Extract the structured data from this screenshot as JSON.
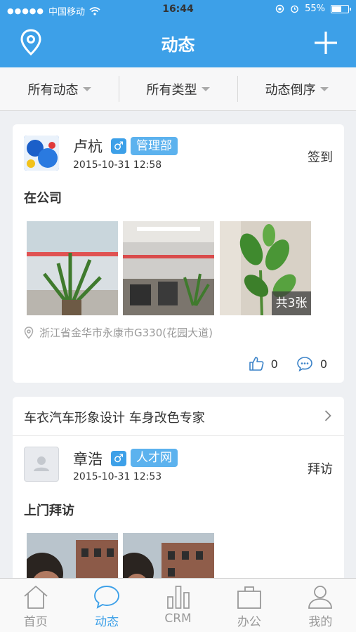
{
  "status_bar": {
    "carrier": "中国移动",
    "time": "16:44",
    "battery": "55%"
  },
  "header": {
    "title": "动态"
  },
  "filters": [
    {
      "label": "所有动态"
    },
    {
      "label": "所有类型"
    },
    {
      "label": "动态倒序"
    }
  ],
  "post1": {
    "name": "卢杭",
    "gender": "♂",
    "dept": "管理部",
    "time": "2015-10-31 12:58",
    "kind": "签到",
    "content": "在公司",
    "photo_count": "共3张",
    "location": "浙江省金华市永康市G330(花园大道)",
    "likes": "0",
    "comments": "0"
  },
  "ad": {
    "text": "车衣汽车形象设计 车身改色专家"
  },
  "post2": {
    "name": "章浩",
    "gender": "♂",
    "dept": "人才网",
    "time": "2015-10-31 12:53",
    "kind": "拜访",
    "content": "上门拜访"
  },
  "tabs": [
    {
      "label": "首页",
      "icon": "home-icon"
    },
    {
      "label": "动态",
      "icon": "chat-bubble-icon"
    },
    {
      "label": "CRM",
      "icon": "bar-chart-icon"
    },
    {
      "label": "办公",
      "icon": "briefcase-icon"
    },
    {
      "label": "我的",
      "icon": "person-icon"
    }
  ],
  "colors": {
    "accent": "#3da0e8",
    "background": "#eef0f3"
  }
}
